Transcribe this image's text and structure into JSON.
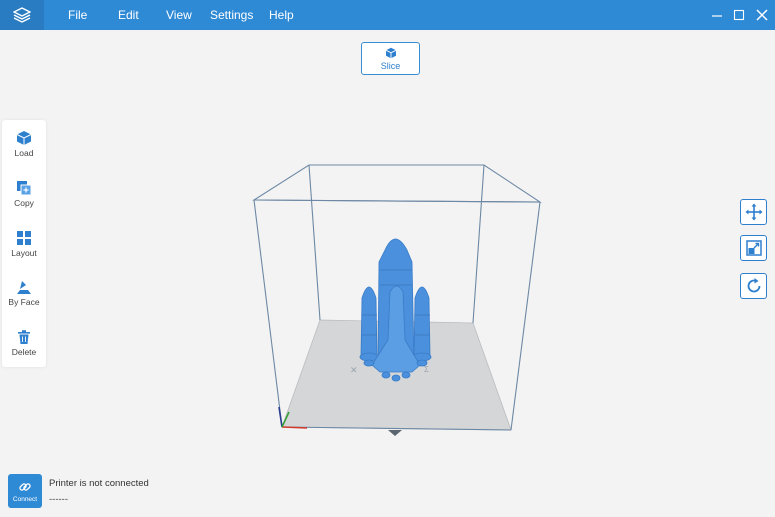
{
  "menu": {
    "file": "File",
    "edit": "Edit",
    "view": "View",
    "settings": "Settings",
    "help": "Help"
  },
  "slice": {
    "label": "Slice"
  },
  "left_toolbar": {
    "load": "Load",
    "copy": "Copy",
    "layout": "Layout",
    "by_face": "By Face",
    "delete": "Delete"
  },
  "right_toolbar": {
    "move": "move-icon",
    "scale": "scale-icon",
    "rotate": "rotate-icon"
  },
  "status": {
    "connect_label": "Connect",
    "printer_status": "Printer is not connected",
    "printer_sub": "------"
  },
  "colors": {
    "titlebar": "#2f8ad6",
    "accent": "#2f7fcf",
    "model": "#4a90dc",
    "background": "#f3f3f3"
  }
}
